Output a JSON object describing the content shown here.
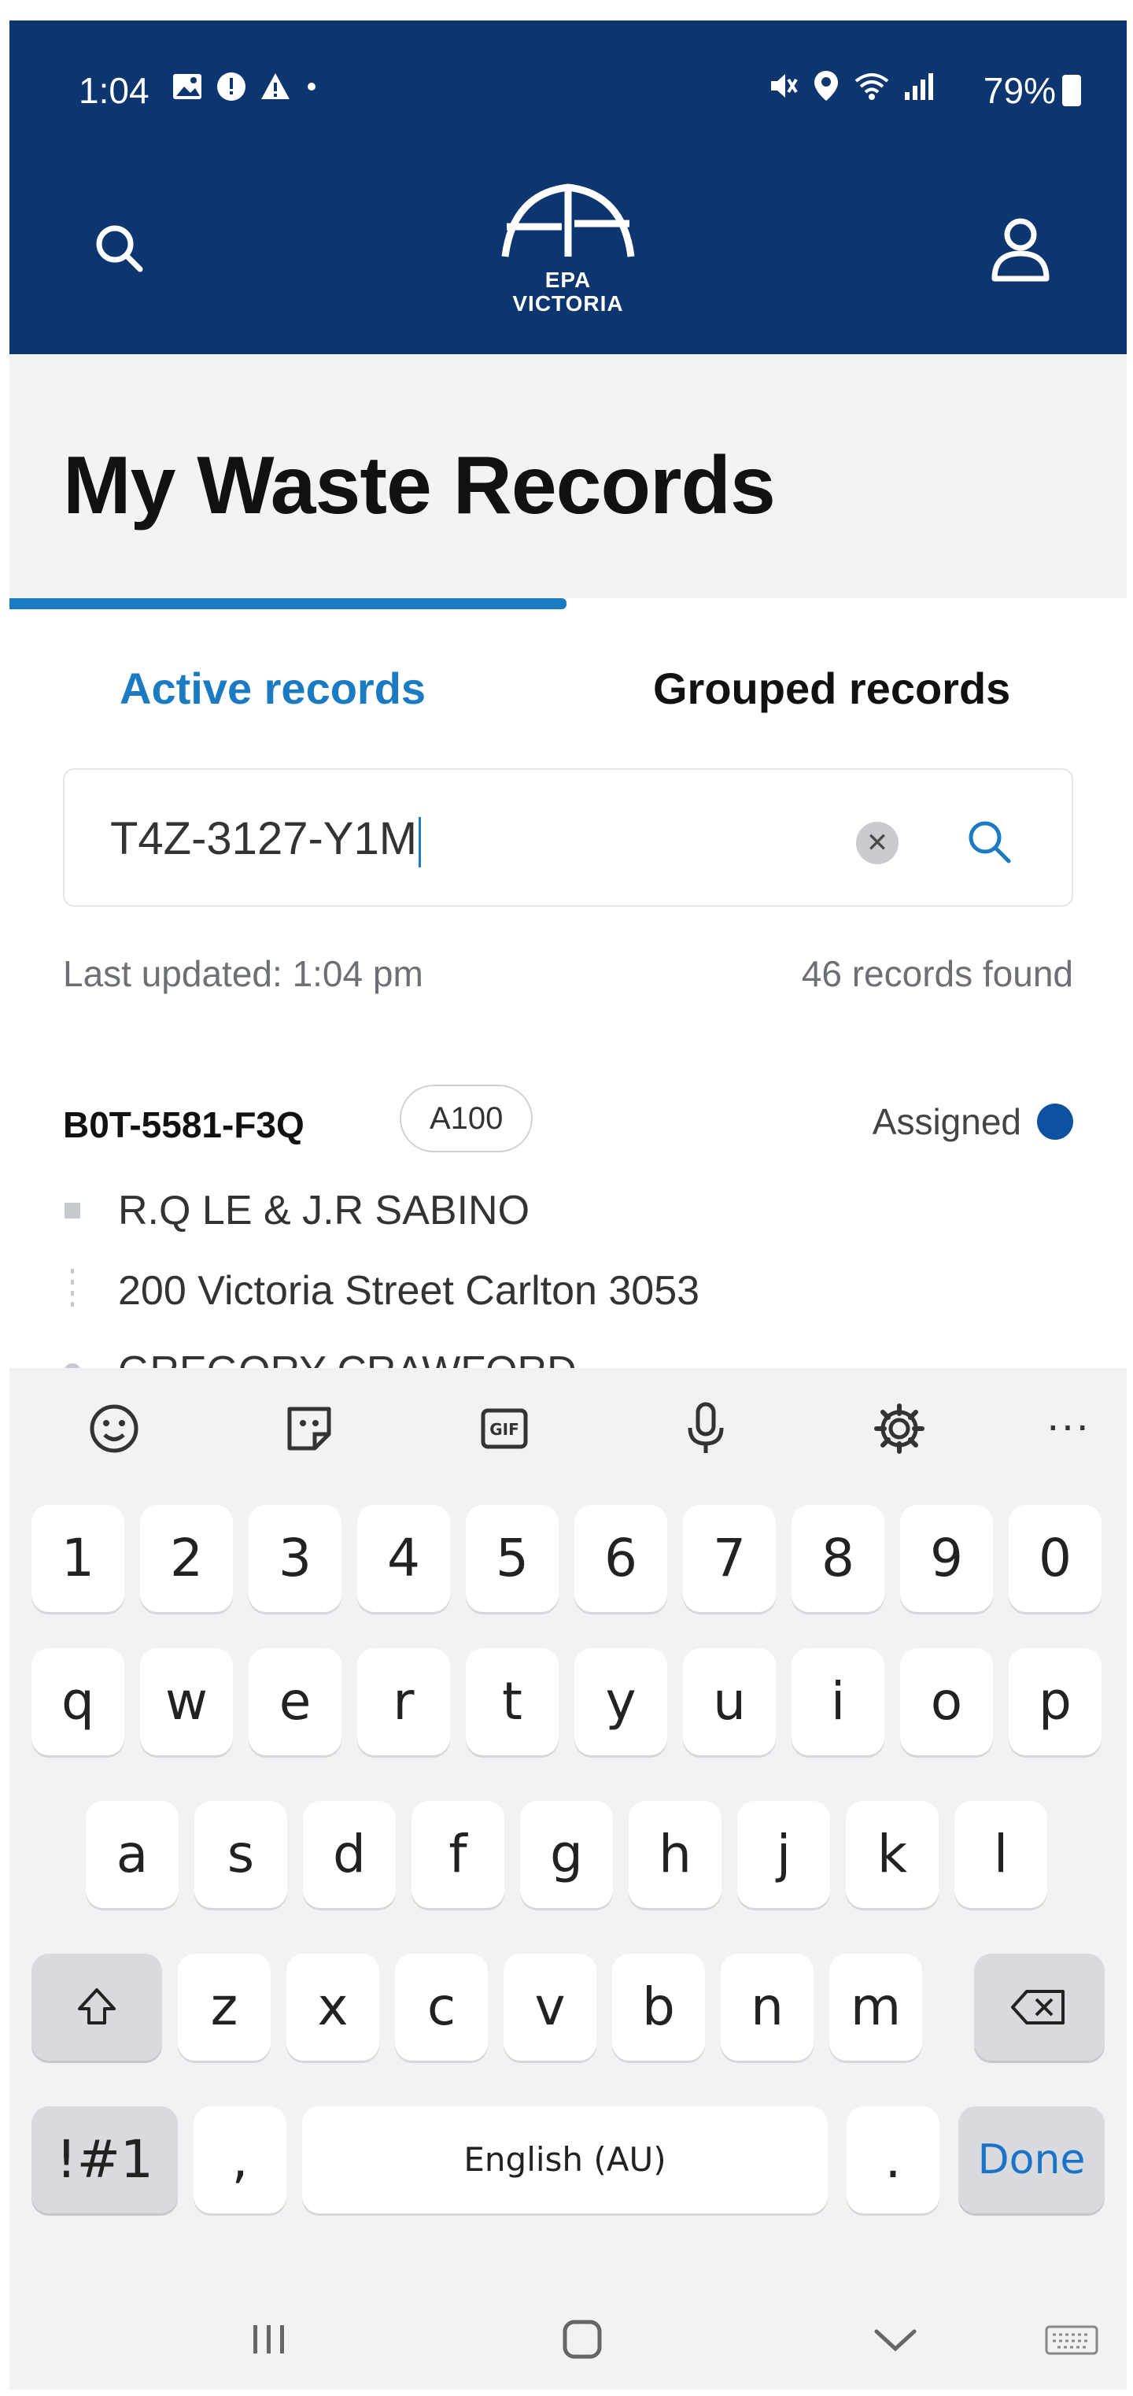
{
  "status_bar": {
    "time": "1:04",
    "battery": "79%",
    "icons_left": [
      "image-icon",
      "alert-icon",
      "warning-icon",
      "dot"
    ],
    "icons_right": [
      "mute-icon",
      "location-icon",
      "wifi-icon",
      "signal-icon",
      "battery-icon"
    ]
  },
  "header": {
    "logo_line1": "EPA",
    "logo_line2": "VICTORIA"
  },
  "page": {
    "title": "My Waste Records"
  },
  "tabs": {
    "active": "Active records",
    "grouped": "Grouped records"
  },
  "search": {
    "value": "T4Z-3127-Y1M"
  },
  "meta": {
    "last_updated": "Last updated: 1:04 pm",
    "count": "46 records found"
  },
  "record": {
    "id": "B0T-5581-F3Q",
    "badge": "A100",
    "status": "Assigned",
    "line1": "R.Q LE & J.R SABINO",
    "line2": "200 Victoria Street Carlton 3053",
    "line3": "GREGORY CRAWFORD"
  },
  "keyboard": {
    "row_numbers": [
      "1",
      "2",
      "3",
      "4",
      "5",
      "6",
      "7",
      "8",
      "9",
      "0"
    ],
    "row_q": [
      "q",
      "w",
      "e",
      "r",
      "t",
      "y",
      "u",
      "i",
      "o",
      "p"
    ],
    "row_a": [
      "a",
      "s",
      "d",
      "f",
      "g",
      "h",
      "j",
      "k",
      "l"
    ],
    "row_z": [
      "z",
      "x",
      "c",
      "v",
      "b",
      "n",
      "m"
    ],
    "symbols_label": "!#1",
    "comma": ",",
    "space_label": "English (AU)",
    "period": ".",
    "done_label": "Done",
    "toolbar_gif": "GIF",
    "toolbar_more": "···"
  },
  "colors": {
    "header_bg": "#0d3670",
    "accent": "#1a7ac2",
    "status_dot": "#0d52a0"
  }
}
